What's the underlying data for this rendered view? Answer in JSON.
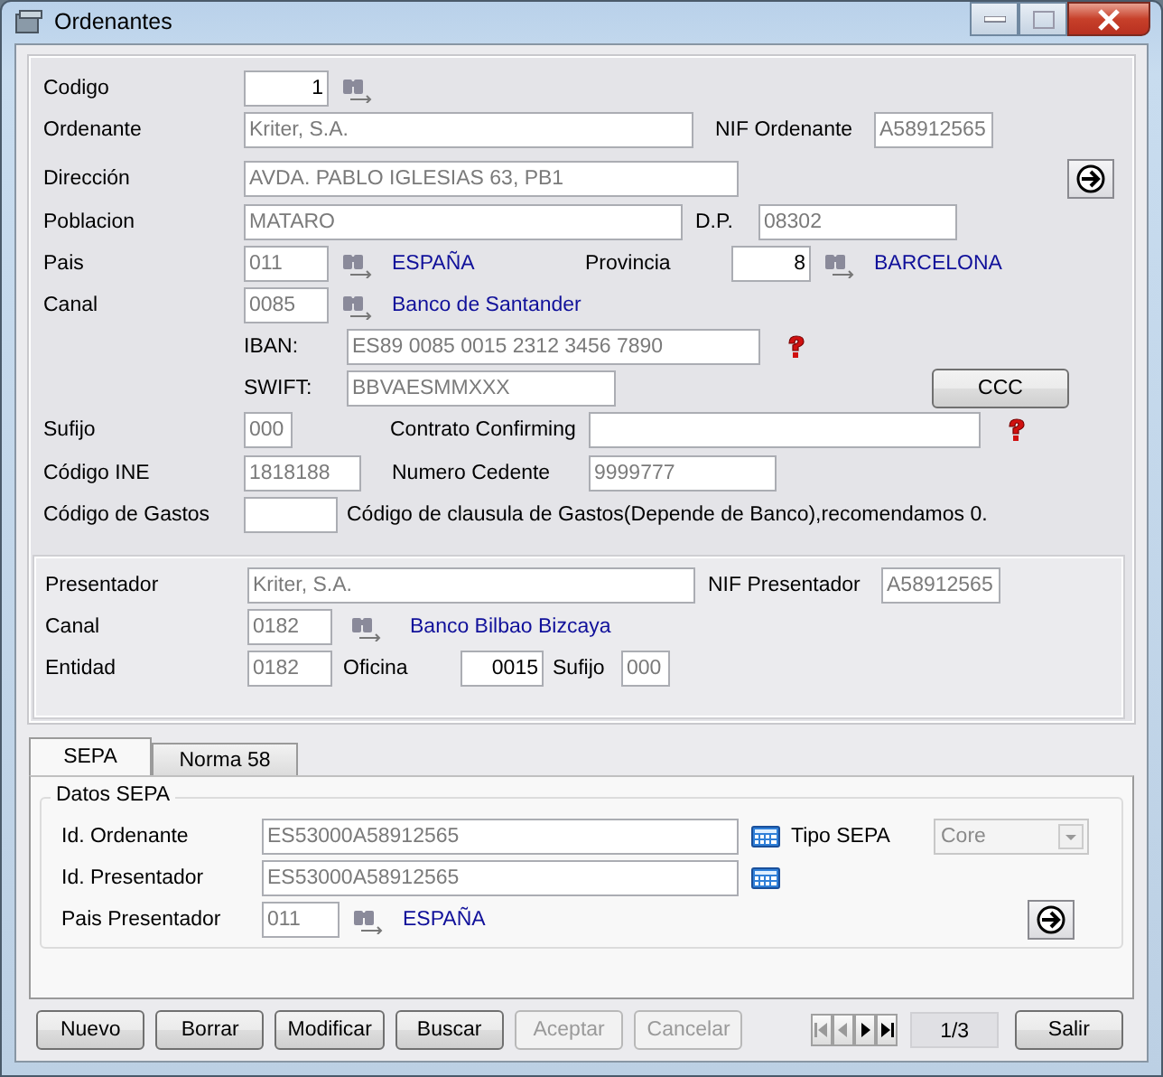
{
  "window": {
    "title": "Ordenantes"
  },
  "ordenante": {
    "codigo": {
      "label": "Codigo",
      "value": "1",
      "readonly": false
    },
    "ordenante": {
      "label": "Ordenante",
      "value": "Kriter, S.A.",
      "readonly": true
    },
    "nif": {
      "label": "NIF Ordenante",
      "value": "A58912565",
      "readonly": true
    },
    "direccion": {
      "label": "Dirección",
      "value": "AVDA. PABLO IGLESIAS 63, PB1",
      "readonly": true
    },
    "poblacion": {
      "label": "Poblacion",
      "value": "MATARO",
      "readonly": true
    },
    "dp": {
      "label": "D.P.",
      "value": "08302",
      "readonly": true
    },
    "pais": {
      "label": "Pais",
      "value": "011",
      "readonly": true,
      "name": "ESPAÑA"
    },
    "provincia": {
      "label": "Provincia",
      "value": "8",
      "readonly": false,
      "name": "BARCELONA"
    },
    "canal": {
      "label": "Canal",
      "value": "0085",
      "readonly": true,
      "name": "Banco de Santander"
    },
    "iban": {
      "label": "IBAN:",
      "value": "ES89 0085 0015 2312 3456 7890",
      "readonly": true
    },
    "swift": {
      "label": "SWIFT:",
      "value": "BBVAESMMXXX",
      "readonly": true
    },
    "ccc_button": "CCC",
    "sufijo": {
      "label": "Sufijo",
      "value": "000",
      "readonly": true
    },
    "contrato": {
      "label": "Contrato Confirming"
    },
    "ine": {
      "label": "Código INE",
      "value": "1818188",
      "readonly": true
    },
    "cedente": {
      "label": "Numero Cedente",
      "value": "9999777",
      "readonly": true
    },
    "gastos": {
      "label": "Código de Gastos",
      "note": "Código de clausula de Gastos(Depende de Banco),recomendamos 0."
    }
  },
  "presentador": {
    "presentador": {
      "label": "Presentador",
      "value": "Kriter, S.A.",
      "readonly": true
    },
    "nif": {
      "label": "NIF Presentador",
      "value": "A58912565",
      "readonly": true
    },
    "canal": {
      "label": "Canal",
      "value": "0182",
      "readonly": true,
      "name": "Banco Bilbao Bizcaya"
    },
    "entidad": {
      "label": "Entidad",
      "value": "0182",
      "readonly": true
    },
    "oficina": {
      "label": "Oficina",
      "value": "0015",
      "readonly": false
    },
    "sufijo": {
      "label": "Sufijo",
      "value": "000",
      "readonly": true
    }
  },
  "tabs": [
    {
      "label": "SEPA",
      "selected": true
    },
    {
      "label": "Norma 58",
      "selected": false
    }
  ],
  "sepa": {
    "group": "Datos SEPA",
    "id_ordenante": {
      "label": "Id. Ordenante",
      "value": "ES53000A58912565",
      "readonly": true
    },
    "id_presentador": {
      "label": "Id. Presentador",
      "value": "ES53000A58912565",
      "readonly": true
    },
    "tipo": {
      "label": "Tipo SEPA",
      "value": "Core",
      "disabled": true
    },
    "pais": {
      "label": "Pais Presentador",
      "value": "011",
      "readonly": true,
      "name": "ESPAÑA"
    }
  },
  "buttons": [
    {
      "label": "Nuevo",
      "disabled": false
    },
    {
      "label": "Borrar",
      "disabled": false
    },
    {
      "label": "Modificar",
      "disabled": false
    },
    {
      "label": "Buscar",
      "disabled": false
    },
    {
      "label": "Aceptar",
      "disabled": true
    },
    {
      "label": "Cancelar",
      "disabled": true
    }
  ],
  "record": "1/3",
  "exit_button": {
    "label": "Salir",
    "disabled": false
  }
}
